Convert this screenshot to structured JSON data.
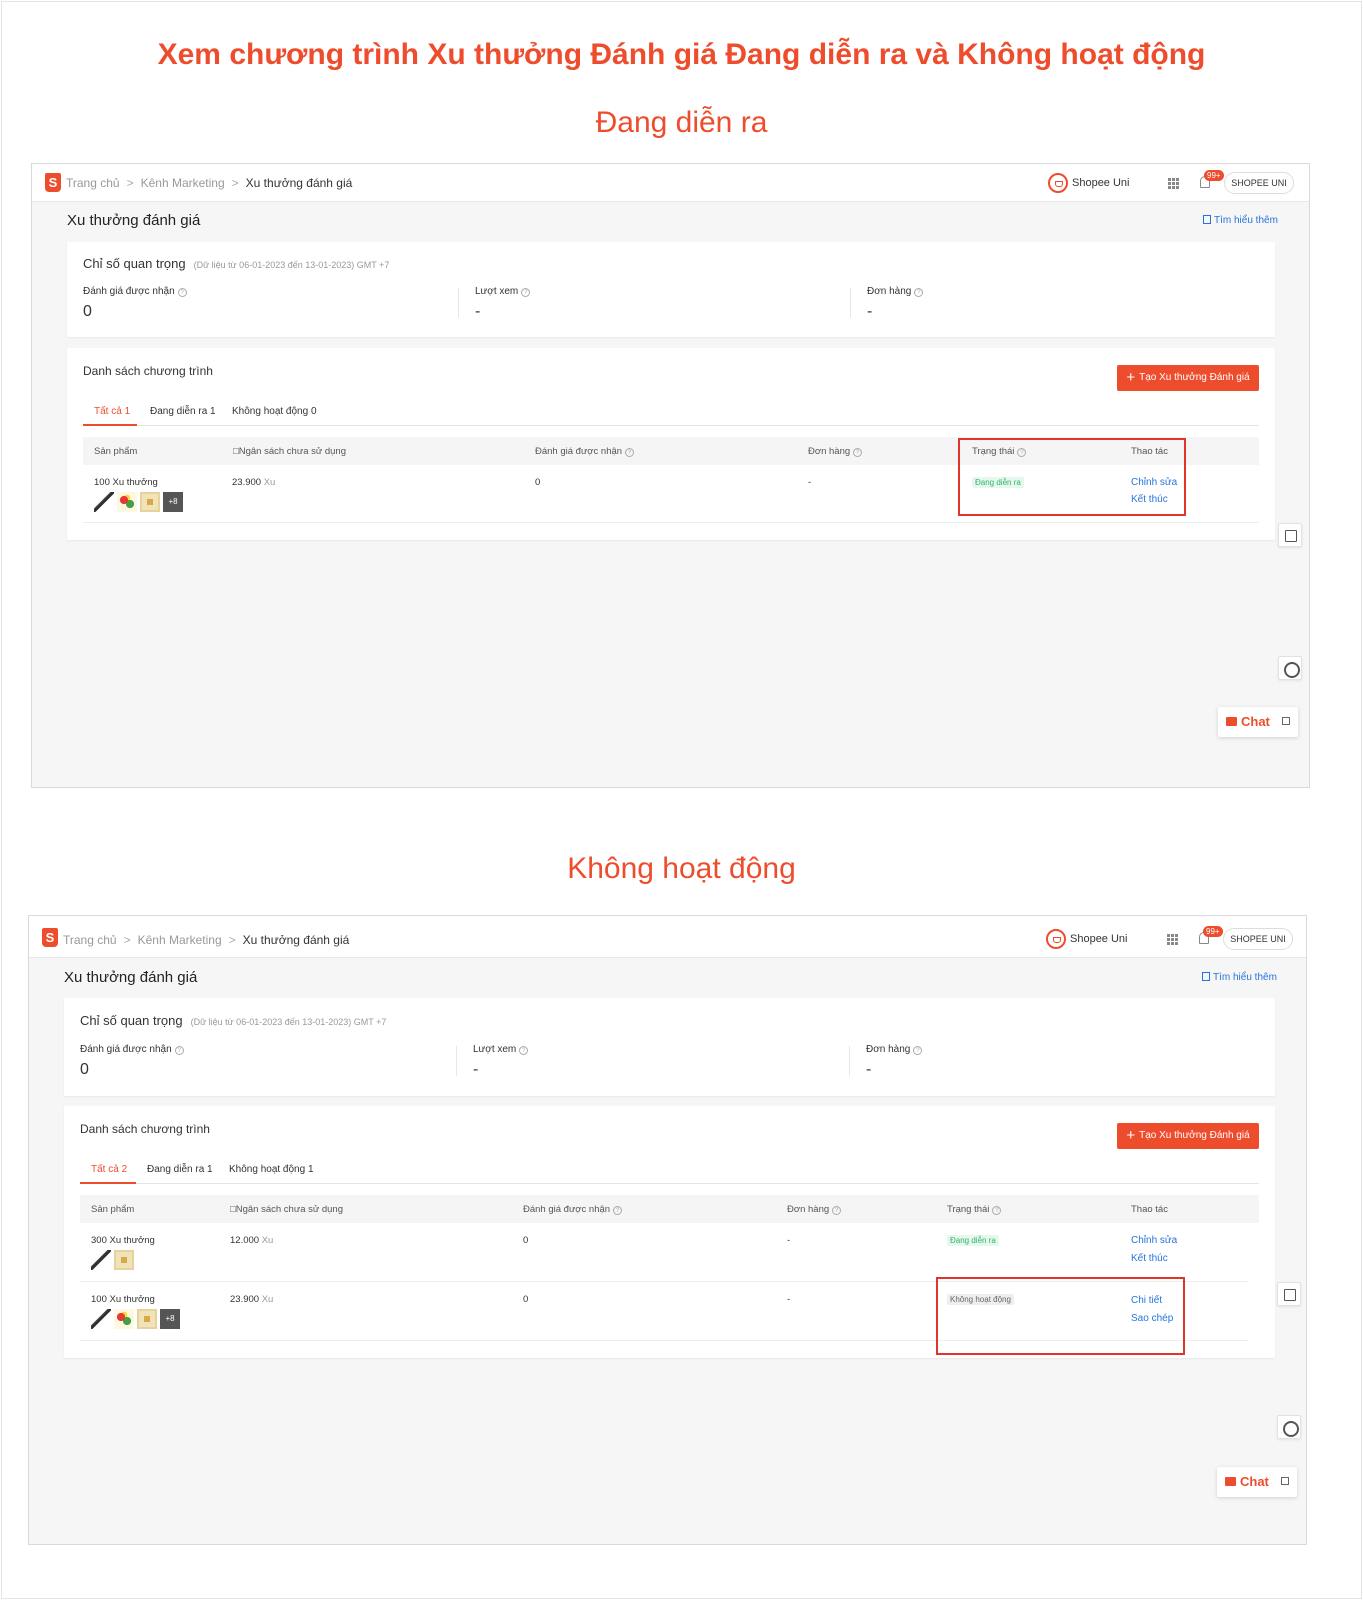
{
  "main_title": "Xem chương trình Xu thưởng Đánh giá Đang diễn ra và Không hoạt động",
  "sections": [
    {
      "heading": "Đang diễn ra",
      "breadcrumb": [
        "Trang chủ",
        "Kênh Marketing",
        "Xu thưởng đánh giá"
      ],
      "shopee_uni": "Shopee Uni",
      "notif_badge": "99+",
      "shopee_uni_pill": "SHOPEE UNI",
      "page_title": "Xu thưởng đánh giá",
      "learn_more": "Tìm hiểu thêm",
      "metrics_title": "Chỉ số quan trọng",
      "metrics_range": "(Dữ liệu từ 06-01-2023 đến 13-01-2023) GMT +7",
      "metrics": [
        {
          "label": "Đánh giá được nhận",
          "value": "0"
        },
        {
          "label": "Lượt xem",
          "value": "-"
        },
        {
          "label": "Đơn hàng",
          "value": "-"
        }
      ],
      "list_title": "Danh sách chương trình",
      "create_button": "Tạo Xu thưởng Đánh giá",
      "tabs": [
        "Tất cả 1",
        "Đang diễn ra 1",
        "Không hoạt động 0"
      ],
      "columns": [
        "Sản phẩm",
        "□Ngân sách chưa sử dụng",
        "Đánh giá được nhận",
        "Đơn hàng",
        "Trạng thái",
        "Thao tác"
      ],
      "rows": [
        {
          "name": "100 Xu thưởng",
          "more": "+8",
          "budget": "23.900",
          "unit": "Xu",
          "reviews": "0",
          "orders": "-",
          "status": "Đang diễn ra",
          "status_kind": "on",
          "actions": [
            "Chỉnh sửa",
            "Kết thúc"
          ]
        }
      ],
      "chat_label": "Chat"
    },
    {
      "heading": "Không hoạt động",
      "breadcrumb": [
        "Trang chủ",
        "Kênh Marketing",
        "Xu thưởng đánh giá"
      ],
      "shopee_uni": "Shopee Uni",
      "notif_badge": "99+",
      "shopee_uni_pill": "SHOPEE UNI",
      "page_title": "Xu thưởng đánh giá",
      "learn_more": "Tìm hiểu thêm",
      "metrics_title": "Chỉ số quan trọng",
      "metrics_range": "(Dữ liệu từ 06-01-2023 đến 13-01-2023) GMT +7",
      "metrics": [
        {
          "label": "Đánh giá được nhận",
          "value": "0"
        },
        {
          "label": "Lượt xem",
          "value": "-"
        },
        {
          "label": "Đơn hàng",
          "value": "-"
        }
      ],
      "list_title": "Danh sách chương trình",
      "create_button": "Tạo Xu thưởng Đánh giá",
      "tabs": [
        "Tất cả 2",
        "Đang diễn ra 1",
        "Không hoạt động 1"
      ],
      "columns": [
        "Sản phẩm",
        "□Ngân sách chưa sử dụng",
        "Đánh giá được nhận",
        "Đơn hàng",
        "Trạng thái",
        "Thao tác"
      ],
      "rows": [
        {
          "name": "300 Xu thưởng",
          "more": "",
          "budget": "12.000",
          "unit": "Xu",
          "reviews": "0",
          "orders": "-",
          "status": "Đang diễn ra",
          "status_kind": "on",
          "actions": [
            "Chỉnh sửa",
            "Kết thúc"
          ]
        },
        {
          "name": "100 Xu thưởng",
          "more": "+8",
          "budget": "23.900",
          "unit": "Xu",
          "reviews": "0",
          "orders": "-",
          "status": "Không hoạt động",
          "status_kind": "off",
          "actions": [
            "Chi tiết",
            "Sao chép"
          ]
        }
      ],
      "chat_label": "Chat"
    }
  ],
  "colors": {
    "accent": "#ee4d2d",
    "link": "#2673dd",
    "highlight_box": "#e0352b",
    "status_on": "#30b566"
  }
}
